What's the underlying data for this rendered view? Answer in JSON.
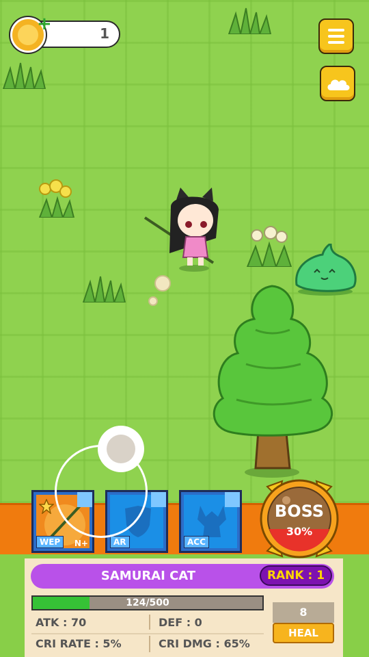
{
  "hud": {
    "coin_count": "1",
    "menu_icon": "hamburger-menu-icon",
    "cloud_icon": "cloud-save-icon"
  },
  "equipment": {
    "weapon_tag": "WEP",
    "weapon_badge": "N+",
    "armor_tag": "AR",
    "accessory_tag": "ACC"
  },
  "boss": {
    "label": "BOSS",
    "progress": "30%"
  },
  "character": {
    "name": "SAMURAI CAT",
    "rank": "RANK : 1",
    "hp_text": "124/500",
    "hp_fraction": 0.248,
    "atk": "ATK : 70",
    "def": "DEF : 0",
    "cri_rate": "CRI RATE : 5%",
    "cri_dmg": "CRI DMG : 65%"
  },
  "heal": {
    "count": "8",
    "label": "HEAL"
  },
  "colors": {
    "grass": "#8fd24f",
    "accent_orange": "#f07b0e",
    "name_bar": "#b951e9",
    "hp_green": "#36c236",
    "slime": "#4cd17a"
  }
}
